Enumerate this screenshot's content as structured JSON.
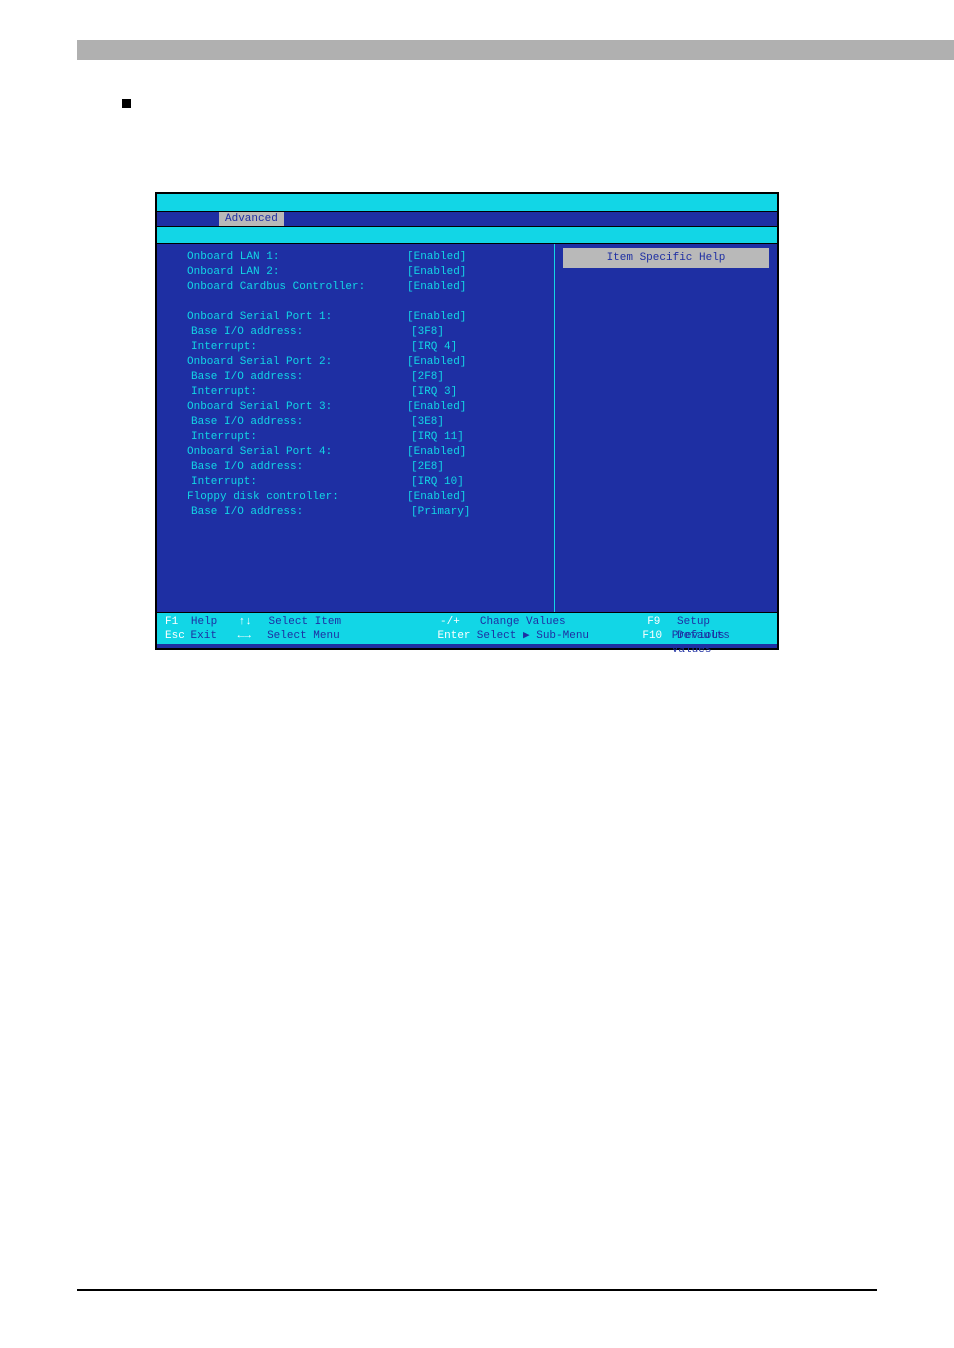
{
  "menu": {
    "active_tab": "Advanced"
  },
  "settings": [
    {
      "label": "Onboard LAN 1:",
      "value": "[Enabled]"
    },
    {
      "label": "Onboard LAN 2:",
      "value": "[Enabled]"
    },
    {
      "label": "Onboard Cardbus Controller:",
      "value": "[Enabled]"
    },
    {
      "label": "",
      "value": ""
    },
    {
      "label": "Onboard Serial Port 1:",
      "value": "[Enabled]"
    },
    {
      "label": "Base I/O address:",
      "value": "[3F8]"
    },
    {
      "label": "Interrupt:",
      "value": "[IRQ 4]"
    },
    {
      "label": "Onboard Serial Port 2:",
      "value": "[Enabled]"
    },
    {
      "label": "Base I/O address:",
      "value": "[2F8]"
    },
    {
      "label": "Interrupt:",
      "value": "[IRQ 3]"
    },
    {
      "label": "Onboard Serial Port 3:",
      "value": "[Enabled]"
    },
    {
      "label": "Base I/O address:",
      "value": "[3E8]"
    },
    {
      "label": "Interrupt:",
      "value": "[IRQ 11]"
    },
    {
      "label": "Onboard Serial Port 4:",
      "value": "[Enabled]"
    },
    {
      "label": "Base I/O address:",
      "value": "[2E8]"
    },
    {
      "label": "Interrupt:",
      "value": "[IRQ 10]"
    },
    {
      "label": "Floppy disk controller:",
      "value": "[Enabled]"
    },
    {
      "label": "Base I/O address:",
      "value": "[Primary]"
    }
  ],
  "help": {
    "title": "Item Specific Help"
  },
  "footer": {
    "r1k1": "F1",
    "r1a1": "Help",
    "r1s1": "↑↓",
    "r1a2": "Select Item",
    "r1k2": "-/+",
    "r1a3": "Change Values",
    "r1k3": "F9",
    "r1a4": "Setup Defaults",
    "r2k1": "Esc",
    "r2a1": "Exit",
    "r2s1": "←→",
    "r2a2": "Select Menu",
    "r2k2": "Enter",
    "r2a3": "Select ▶ Sub-Menu",
    "r2k3": "F10",
    "r2a4": "Previous Values"
  }
}
